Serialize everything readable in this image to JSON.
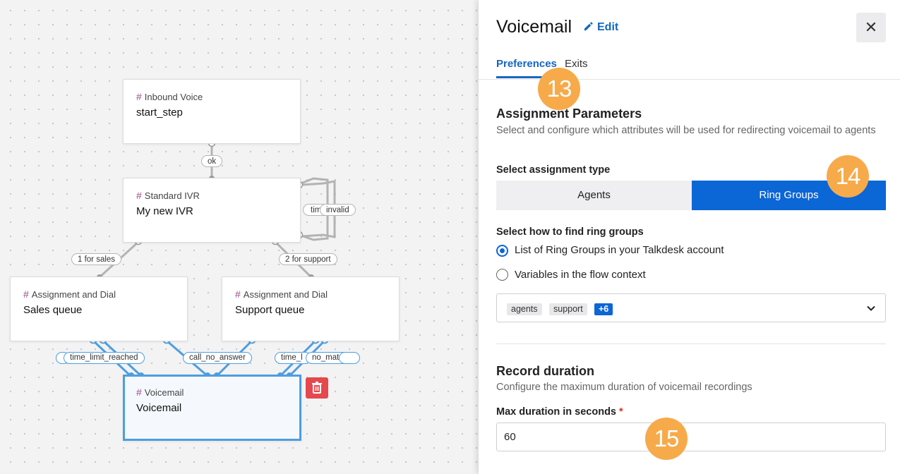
{
  "flow": {
    "nodes": [
      {
        "id": "start",
        "type": "Inbound Voice",
        "name": "start_step"
      },
      {
        "id": "ivr",
        "type": "Standard IVR",
        "name": "My new IVR"
      },
      {
        "id": "sales",
        "type": "Assignment and Dial",
        "name": "Sales queue"
      },
      {
        "id": "support",
        "type": "Assignment and Dial",
        "name": "Support queue"
      },
      {
        "id": "voicemail",
        "type": "Voicemail",
        "name": "Voicemail"
      }
    ],
    "edge_labels": {
      "ok": "ok",
      "ivr_timeout": "tim",
      "ivr_invalid": "invalid",
      "for_sales": "1 for sales",
      "for_support": "2 for support",
      "time_limit_reached": "time_limit_reached",
      "call_no_answer": "call_no_answer",
      "time_limit_trunc": "time_l",
      "no_match": "no_match"
    },
    "hash_symbol": "#",
    "selected_color": "#4d9ee0",
    "delete_color": "#e5484d"
  },
  "panel": {
    "title": "Voicemail",
    "edit_label": "Edit",
    "close_symbol": "✕",
    "tabs": [
      {
        "label": "Preferences",
        "active": true
      },
      {
        "label": "Exits",
        "active": false
      }
    ],
    "badges": [
      "13",
      "14",
      "15"
    ],
    "assignment": {
      "heading": "Assignment Parameters",
      "description": "Select and configure which attributes will be used for redirecting voicemail to agents",
      "type_label": "Select assignment type",
      "options": [
        "Agents",
        "Ring Groups"
      ],
      "selected": "Ring Groups",
      "find_label": "Select how to find ring groups",
      "find_options": [
        {
          "label": "List of Ring Groups in your Talkdesk account",
          "checked": true
        },
        {
          "label": "Variables in the flow context",
          "checked": false
        }
      ],
      "chips": [
        "agents",
        "support"
      ],
      "more_chip": "+6"
    },
    "record": {
      "heading": "Record duration",
      "description": "Configure the maximum duration of voicemail recordings",
      "max_label": "Max duration in seconds",
      "required_mark": "*",
      "value": "60"
    },
    "colors": {
      "accent": "#0b66d6",
      "badge": "#f7aa4a",
      "link": "#1566c0"
    }
  }
}
